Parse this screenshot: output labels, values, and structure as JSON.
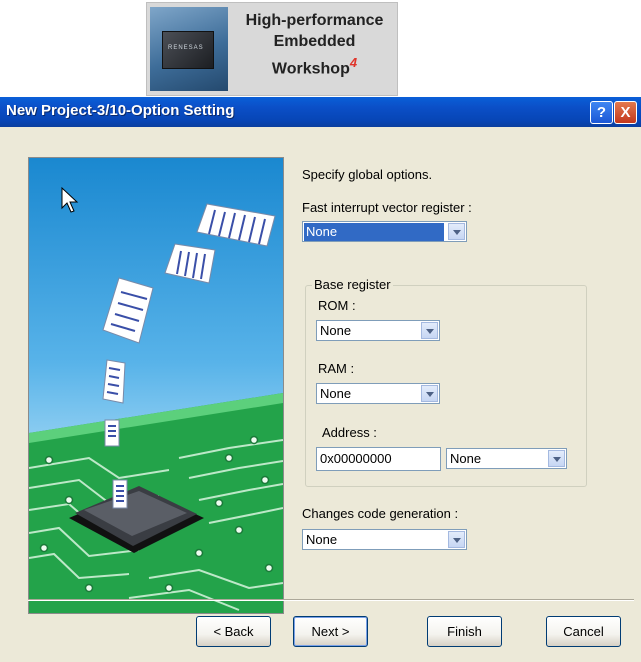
{
  "logo": {
    "chip_text": "RENESAS",
    "line1": "High-performance",
    "line2": "Embedded",
    "line3": "Workshop",
    "version": "4"
  },
  "window": {
    "title": "New Project-3/10-Option Setting",
    "help_label": "?",
    "close_label": "X"
  },
  "form": {
    "intro": "Specify global options.",
    "fast_interrupt": {
      "label": "Fast interrupt vector register :",
      "value": "None"
    },
    "base_register": {
      "legend": "Base register",
      "rom": {
        "label": "ROM :",
        "value": "None"
      },
      "ram": {
        "label": "RAM :",
        "value": "None"
      },
      "address": {
        "label": "Address :",
        "value": "0x00000000",
        "select_value": "None"
      }
    },
    "changes_code": {
      "label": "Changes code generation :",
      "value": "None"
    }
  },
  "buttons": {
    "back": "< Back",
    "next": "Next >",
    "finish": "Finish",
    "cancel": "Cancel"
  },
  "colors": {
    "titlebar": "#0a5fd8",
    "dialog_bg": "#ece9d8",
    "selection": "#316ac5"
  }
}
